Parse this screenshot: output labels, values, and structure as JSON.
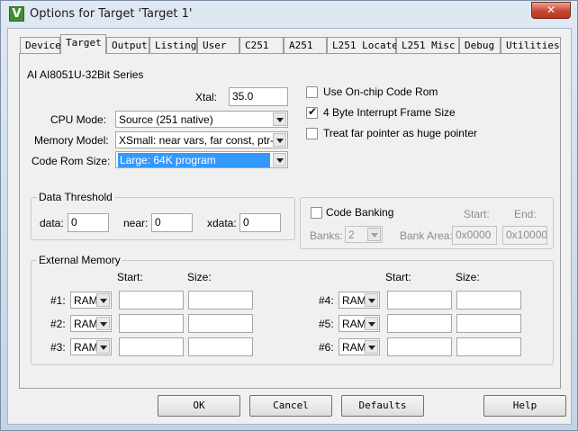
{
  "window": {
    "title": "Options for Target 'Target 1'",
    "icon": "keil-uvision-icon",
    "close_glyph": "✕"
  },
  "tabs": [
    {
      "label": "Device"
    },
    {
      "label": "Target"
    },
    {
      "label": "Output"
    },
    {
      "label": "Listing"
    },
    {
      "label": "User"
    },
    {
      "label": "C251"
    },
    {
      "label": "A251"
    },
    {
      "label": "L251 Locate"
    },
    {
      "label": "L251 Misc"
    },
    {
      "label": "Debug"
    },
    {
      "label": "Utilities"
    }
  ],
  "active_tab": "Target",
  "target": {
    "device_name": "AI AI8051U-32Bit Series",
    "xtal": {
      "label": "Xtal:",
      "value": "35.0"
    },
    "cpu_mode": {
      "label": "CPU Mode:",
      "value": "Source (251 native)"
    },
    "memory_model": {
      "label": "Memory Model:",
      "value": "XSmall: near vars, far const, ptr-4"
    },
    "code_rom_size": {
      "label": "Code Rom Size:",
      "value": "Large: 64K program"
    },
    "options": [
      {
        "label": "Use On-chip Code Rom",
        "checked": false
      },
      {
        "label": "4 Byte Interrupt Frame Size",
        "checked": true
      },
      {
        "label": "Treat far pointer as huge pointer",
        "checked": false
      }
    ]
  },
  "data_threshold": {
    "title": "Data Threshold",
    "data": {
      "label": "data:",
      "value": "0"
    },
    "near": {
      "label": "near:",
      "value": "0"
    },
    "xdata": {
      "label": "xdata:",
      "value": "0"
    }
  },
  "code_banking": {
    "label": "Code Banking",
    "checked": false,
    "banks": {
      "label": "Banks:",
      "value": "2"
    },
    "bank_area": {
      "label": "Bank Area:",
      "start_header": "Start:",
      "end_header": "End:",
      "start": "0x0000",
      "end": "0x10000"
    }
  },
  "external_memory": {
    "title": "External Memory",
    "start_header": "Start:",
    "size_header": "Size:",
    "rows": [
      {
        "label": "#1:",
        "type": "RAM",
        "start": "",
        "size": ""
      },
      {
        "label": "#2:",
        "type": "RAM",
        "start": "",
        "size": ""
      },
      {
        "label": "#3:",
        "type": "RAM",
        "start": "",
        "size": ""
      },
      {
        "label": "#4:",
        "type": "RAM",
        "start": "",
        "size": ""
      },
      {
        "label": "#5:",
        "type": "RAM",
        "start": "",
        "size": ""
      },
      {
        "label": "#6:",
        "type": "RAM",
        "start": "",
        "size": ""
      }
    ]
  },
  "buttons": {
    "ok": "OK",
    "cancel": "Cancel",
    "defaults": "Defaults",
    "help": "Help"
  }
}
